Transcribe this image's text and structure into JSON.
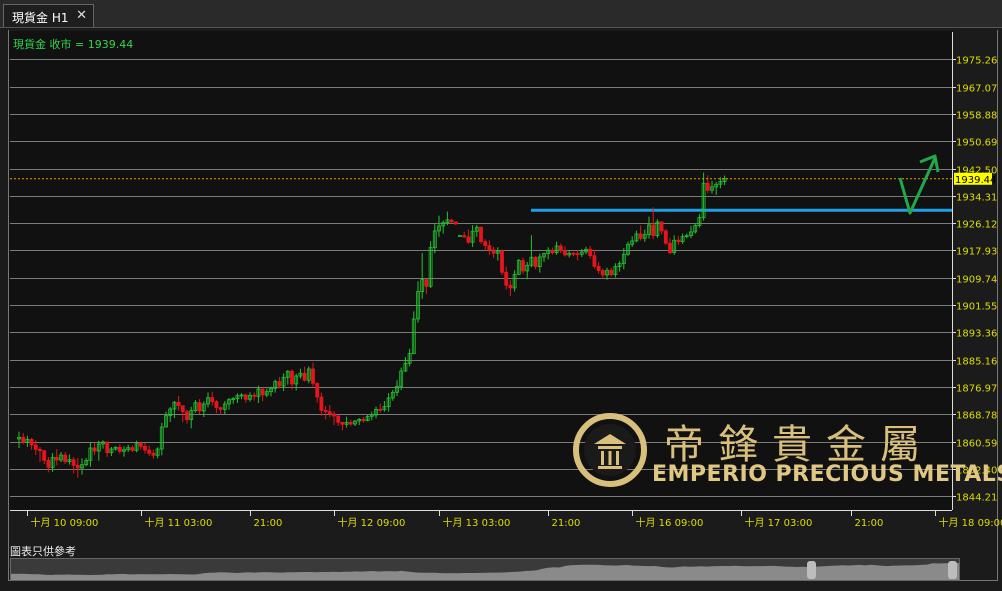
{
  "tab": {
    "label": "現貨金 H1",
    "close_glyph": "✕"
  },
  "legend": {
    "text": "現貨金 收市 = 1939.44"
  },
  "disclaimer": "圖表只供參考",
  "brand": {
    "cn": "帝鋒貴金屬",
    "en": "EMPERIO PRECIOUS METALS"
  },
  "colors": {
    "background": "#111111",
    "grid": "#7a7a7a",
    "up": "#22c32e",
    "down": "#e8141c",
    "axis_text": "#dddd00",
    "price_line": "#e8a000",
    "support_line": "#1ea0e6",
    "arrow": "#22a84a",
    "brand_gold": "#d9bf7c"
  },
  "chart_data": {
    "type": "candlestick",
    "timeframe": "H1",
    "ylim": [
      1840.11,
      1983.45
    ],
    "y_ticks": [
      "1975.26",
      "1967.07",
      "1958.88",
      "1950.69",
      "1942.50",
      "1934.31",
      "1926.12",
      "1917.93",
      "1909.74",
      "1901.55",
      "1893.36",
      "1885.16",
      "1876.97",
      "1868.78",
      "1860.59",
      "1852.40",
      "1844.21"
    ],
    "last_price": "1939.44",
    "x_ticks": [
      "十月 10 09:00",
      "十月 11 03:00",
      "21:00",
      "十月 12 09:00",
      "十月 13 03:00",
      "21:00",
      "十月 16 09:00",
      "十月 17 03:00",
      "21:00",
      "十月 18 09:00"
    ],
    "x_tick_bars": [
      2,
      29,
      55,
      75,
      100,
      126,
      146,
      172,
      198,
      218
    ],
    "support_level": 1930.0,
    "candles": [
      {
        "o": 1861.4,
        "h": 1863.6,
        "l": 1858.7,
        "c": 1861.9
      },
      {
        "o": 1861.9,
        "h": 1863.2,
        "l": 1859.8,
        "c": 1860.4
      },
      {
        "o": 1860.4,
        "h": 1862.4,
        "l": 1859.0,
        "c": 1861.3
      },
      {
        "o": 1861.3,
        "h": 1861.7,
        "l": 1858.2,
        "c": 1859.6
      },
      {
        "o": 1859.6,
        "h": 1861.1,
        "l": 1856.6,
        "c": 1858.3
      },
      {
        "o": 1858.3,
        "h": 1859.0,
        "l": 1854.5,
        "c": 1857.9
      },
      {
        "o": 1857.9,
        "h": 1858.1,
        "l": 1853.9,
        "c": 1855.0
      },
      {
        "o": 1855.0,
        "h": 1856.0,
        "l": 1851.4,
        "c": 1852.9
      },
      {
        "o": 1852.9,
        "h": 1857.2,
        "l": 1851.5,
        "c": 1855.9
      },
      {
        "o": 1855.9,
        "h": 1858.3,
        "l": 1853.5,
        "c": 1855.1
      },
      {
        "o": 1855.1,
        "h": 1857.5,
        "l": 1854.5,
        "c": 1856.6
      },
      {
        "o": 1856.6,
        "h": 1857.5,
        "l": 1853.9,
        "c": 1854.6
      },
      {
        "o": 1854.6,
        "h": 1856.8,
        "l": 1853.7,
        "c": 1855.2
      },
      {
        "o": 1855.2,
        "h": 1856.0,
        "l": 1851.1,
        "c": 1853.5
      },
      {
        "o": 1853.5,
        "h": 1855.7,
        "l": 1849.8,
        "c": 1852.7
      },
      {
        "o": 1852.7,
        "h": 1855.6,
        "l": 1850.7,
        "c": 1853.7
      },
      {
        "o": 1853.7,
        "h": 1855.7,
        "l": 1853.2,
        "c": 1855.0
      },
      {
        "o": 1855.0,
        "h": 1860.3,
        "l": 1853.1,
        "c": 1858.7
      },
      {
        "o": 1858.7,
        "h": 1860.4,
        "l": 1856.6,
        "c": 1857.8
      },
      {
        "o": 1857.8,
        "h": 1860.9,
        "l": 1854.9,
        "c": 1859.9
      },
      {
        "o": 1859.9,
        "h": 1861.0,
        "l": 1858.5,
        "c": 1860.5
      },
      {
        "o": 1860.5,
        "h": 1860.6,
        "l": 1856.0,
        "c": 1857.3
      },
      {
        "o": 1857.3,
        "h": 1859.0,
        "l": 1856.3,
        "c": 1858.4
      },
      {
        "o": 1858.4,
        "h": 1859.2,
        "l": 1857.9,
        "c": 1858.9
      },
      {
        "o": 1858.9,
        "h": 1859.8,
        "l": 1857.0,
        "c": 1857.7
      },
      {
        "o": 1857.7,
        "h": 1859.2,
        "l": 1856.1,
        "c": 1858.2
      },
      {
        "o": 1858.2,
        "h": 1859.7,
        "l": 1857.5,
        "c": 1858.8
      },
      {
        "o": 1858.8,
        "h": 1859.4,
        "l": 1857.5,
        "c": 1858.0
      },
      {
        "o": 1858.0,
        "h": 1860.9,
        "l": 1857.4,
        "c": 1860.2
      },
      {
        "o": 1860.2,
        "h": 1860.6,
        "l": 1858.2,
        "c": 1859.2
      },
      {
        "o": 1859.2,
        "h": 1860.2,
        "l": 1857.0,
        "c": 1858.1
      },
      {
        "o": 1858.1,
        "h": 1859.4,
        "l": 1856.3,
        "c": 1857.1
      },
      {
        "o": 1857.1,
        "h": 1858.2,
        "l": 1855.5,
        "c": 1856.5
      },
      {
        "o": 1856.5,
        "h": 1858.9,
        "l": 1855.6,
        "c": 1858.4
      },
      {
        "o": 1858.4,
        "h": 1866.2,
        "l": 1856.5,
        "c": 1865.0
      },
      {
        "o": 1865.0,
        "h": 1869.6,
        "l": 1864.9,
        "c": 1868.4
      },
      {
        "o": 1868.4,
        "h": 1871.0,
        "l": 1866.5,
        "c": 1870.4
      },
      {
        "o": 1870.4,
        "h": 1872.8,
        "l": 1867.7,
        "c": 1872.4
      },
      {
        "o": 1872.4,
        "h": 1874.3,
        "l": 1869.9,
        "c": 1871.4
      },
      {
        "o": 1871.4,
        "h": 1871.4,
        "l": 1866.4,
        "c": 1869.6
      },
      {
        "o": 1869.6,
        "h": 1870.2,
        "l": 1866.0,
        "c": 1867.2
      },
      {
        "o": 1867.2,
        "h": 1871.1,
        "l": 1864.6,
        "c": 1869.9
      },
      {
        "o": 1869.9,
        "h": 1873.1,
        "l": 1869.3,
        "c": 1872.3
      },
      {
        "o": 1872.3,
        "h": 1873.4,
        "l": 1868.9,
        "c": 1869.8
      },
      {
        "o": 1869.8,
        "h": 1872.7,
        "l": 1868.0,
        "c": 1871.9
      },
      {
        "o": 1871.9,
        "h": 1875.4,
        "l": 1870.9,
        "c": 1873.8
      },
      {
        "o": 1873.8,
        "h": 1875.6,
        "l": 1871.4,
        "c": 1872.6
      },
      {
        "o": 1872.6,
        "h": 1873.1,
        "l": 1869.1,
        "c": 1870.8
      },
      {
        "o": 1870.8,
        "h": 1871.1,
        "l": 1868.7,
        "c": 1870.3
      },
      {
        "o": 1870.3,
        "h": 1872.8,
        "l": 1868.9,
        "c": 1871.9
      },
      {
        "o": 1871.9,
        "h": 1873.7,
        "l": 1870.2,
        "c": 1873.2
      },
      {
        "o": 1873.2,
        "h": 1874.0,
        "l": 1872.0,
        "c": 1873.5
      },
      {
        "o": 1873.5,
        "h": 1875.1,
        "l": 1872.2,
        "c": 1874.4
      },
      {
        "o": 1874.4,
        "h": 1875.1,
        "l": 1873.3,
        "c": 1874.6
      },
      {
        "o": 1874.6,
        "h": 1875.0,
        "l": 1872.3,
        "c": 1873.3
      },
      {
        "o": 1873.3,
        "h": 1875.4,
        "l": 1872.6,
        "c": 1874.5
      },
      {
        "o": 1874.5,
        "h": 1875.3,
        "l": 1872.9,
        "c": 1874.2
      },
      {
        "o": 1874.2,
        "h": 1877.4,
        "l": 1872.2,
        "c": 1876.4
      },
      {
        "o": 1876.4,
        "h": 1876.6,
        "l": 1872.7,
        "c": 1874.6
      },
      {
        "o": 1874.6,
        "h": 1876.6,
        "l": 1873.9,
        "c": 1875.6
      },
      {
        "o": 1875.6,
        "h": 1877.1,
        "l": 1874.2,
        "c": 1876.6
      },
      {
        "o": 1876.6,
        "h": 1879.2,
        "l": 1875.3,
        "c": 1878.6
      },
      {
        "o": 1878.6,
        "h": 1880.0,
        "l": 1876.6,
        "c": 1877.3
      },
      {
        "o": 1877.3,
        "h": 1881.1,
        "l": 1875.8,
        "c": 1879.9
      },
      {
        "o": 1879.9,
        "h": 1882.1,
        "l": 1877.7,
        "c": 1881.7
      },
      {
        "o": 1881.7,
        "h": 1882.3,
        "l": 1876.3,
        "c": 1877.9
      },
      {
        "o": 1877.9,
        "h": 1881.0,
        "l": 1876.0,
        "c": 1880.3
      },
      {
        "o": 1880.3,
        "h": 1882.5,
        "l": 1879.5,
        "c": 1881.1
      },
      {
        "o": 1881.1,
        "h": 1883.1,
        "l": 1878.6,
        "c": 1879.0
      },
      {
        "o": 1879.0,
        "h": 1883.2,
        "l": 1878.1,
        "c": 1882.4
      },
      {
        "o": 1882.4,
        "h": 1884.3,
        "l": 1877.2,
        "c": 1878.1
      },
      {
        "o": 1878.1,
        "h": 1878.3,
        "l": 1872.3,
        "c": 1874.0
      },
      {
        "o": 1874.0,
        "h": 1875.3,
        "l": 1868.4,
        "c": 1870.0
      },
      {
        "o": 1870.0,
        "h": 1871.3,
        "l": 1867.3,
        "c": 1869.6
      },
      {
        "o": 1869.6,
        "h": 1871.6,
        "l": 1867.9,
        "c": 1868.9
      },
      {
        "o": 1868.9,
        "h": 1869.8,
        "l": 1865.6,
        "c": 1868.3
      },
      {
        "o": 1868.3,
        "h": 1868.7,
        "l": 1865.3,
        "c": 1866.4
      },
      {
        "o": 1866.4,
        "h": 1866.5,
        "l": 1864.0,
        "c": 1865.8
      },
      {
        "o": 1865.8,
        "h": 1868.1,
        "l": 1864.8,
        "c": 1866.4
      },
      {
        "o": 1866.4,
        "h": 1867.2,
        "l": 1865.2,
        "c": 1865.9
      },
      {
        "o": 1865.9,
        "h": 1867.1,
        "l": 1865.3,
        "c": 1866.8
      },
      {
        "o": 1866.8,
        "h": 1867.7,
        "l": 1865.6,
        "c": 1867.3
      },
      {
        "o": 1867.3,
        "h": 1868.0,
        "l": 1866.3,
        "c": 1866.9
      },
      {
        "o": 1866.9,
        "h": 1868.6,
        "l": 1866.7,
        "c": 1868.2
      },
      {
        "o": 1868.2,
        "h": 1869.6,
        "l": 1867.0,
        "c": 1868.6
      },
      {
        "o": 1868.6,
        "h": 1871.1,
        "l": 1867.6,
        "c": 1870.3
      },
      {
        "o": 1870.3,
        "h": 1872.0,
        "l": 1869.4,
        "c": 1870.2
      },
      {
        "o": 1870.2,
        "h": 1872.8,
        "l": 1869.6,
        "c": 1871.1
      },
      {
        "o": 1871.1,
        "h": 1875.2,
        "l": 1869.6,
        "c": 1873.7
      },
      {
        "o": 1873.7,
        "h": 1876.1,
        "l": 1872.9,
        "c": 1875.4
      },
      {
        "o": 1875.4,
        "h": 1879.0,
        "l": 1874.3,
        "c": 1877.2
      },
      {
        "o": 1877.2,
        "h": 1882.8,
        "l": 1876.1,
        "c": 1881.8
      },
      {
        "o": 1881.8,
        "h": 1886.0,
        "l": 1881.5,
        "c": 1884.1
      },
      {
        "o": 1884.1,
        "h": 1888.5,
        "l": 1883.2,
        "c": 1887.0
      },
      {
        "o": 1887.0,
        "h": 1899.7,
        "l": 1886.9,
        "c": 1897.4
      },
      {
        "o": 1897.4,
        "h": 1908.7,
        "l": 1896.3,
        "c": 1905.6
      },
      {
        "o": 1905.6,
        "h": 1917.2,
        "l": 1903.4,
        "c": 1909.2
      },
      {
        "o": 1909.2,
        "h": 1909.5,
        "l": 1904.9,
        "c": 1907.2
      },
      {
        "o": 1907.2,
        "h": 1920.7,
        "l": 1906.7,
        "c": 1918.8
      },
      {
        "o": 1918.8,
        "h": 1926.1,
        "l": 1917.1,
        "c": 1923.8
      },
      {
        "o": 1923.8,
        "h": 1928.4,
        "l": 1922.0,
        "c": 1925.3
      },
      {
        "o": 1925.3,
        "h": 1927.0,
        "l": 1923.0,
        "c": 1926.3
      },
      {
        "o": 1926.3,
        "h": 1929.6,
        "l": 1925.5,
        "c": 1927.1
      },
      {
        "o": 1927.1,
        "h": 1927.3,
        "l": 1926.0,
        "c": 1926.5
      },
      {
        "o": 1926.5,
        "h": 1926.6,
        "l": 1925.6,
        "c": 1925.9
      },
      {
        "o": 1922.4,
        "h": 1922.5,
        "l": 1922.3,
        "c": 1922.4
      },
      {
        "o": 1922.4,
        "h": 1923.5,
        "l": 1921.7,
        "c": 1922.0
      },
      {
        "o": 1922.0,
        "h": 1924.2,
        "l": 1919.9,
        "c": 1920.4
      },
      {
        "o": 1920.4,
        "h": 1925.5,
        "l": 1919.0,
        "c": 1923.7
      },
      {
        "o": 1923.7,
        "h": 1925.6,
        "l": 1922.0,
        "c": 1924.9
      },
      {
        "o": 1924.9,
        "h": 1925.1,
        "l": 1919.9,
        "c": 1920.6
      },
      {
        "o": 1920.6,
        "h": 1921.3,
        "l": 1917.9,
        "c": 1919.4
      },
      {
        "o": 1919.4,
        "h": 1921.0,
        "l": 1916.6,
        "c": 1918.1
      },
      {
        "o": 1918.1,
        "h": 1919.0,
        "l": 1915.7,
        "c": 1917.1
      },
      {
        "o": 1917.1,
        "h": 1918.9,
        "l": 1914.9,
        "c": 1917.8
      },
      {
        "o": 1917.8,
        "h": 1918.2,
        "l": 1910.6,
        "c": 1911.4
      },
      {
        "o": 1911.4,
        "h": 1913.1,
        "l": 1906.2,
        "c": 1907.5
      },
      {
        "o": 1907.5,
        "h": 1909.1,
        "l": 1904.3,
        "c": 1906.7
      },
      {
        "o": 1906.7,
        "h": 1912.0,
        "l": 1905.6,
        "c": 1910.8
      },
      {
        "o": 1910.8,
        "h": 1915.4,
        "l": 1910.5,
        "c": 1914.9
      },
      {
        "o": 1914.9,
        "h": 1915.8,
        "l": 1910.9,
        "c": 1911.8
      },
      {
        "o": 1911.8,
        "h": 1914.5,
        "l": 1909.3,
        "c": 1913.5
      },
      {
        "o": 1913.5,
        "h": 1922.5,
        "l": 1912.9,
        "c": 1915.9
      },
      {
        "o": 1915.9,
        "h": 1916.2,
        "l": 1912.3,
        "c": 1913.1
      },
      {
        "o": 1913.1,
        "h": 1917.0,
        "l": 1911.3,
        "c": 1916.0
      },
      {
        "o": 1916.0,
        "h": 1917.3,
        "l": 1914.5,
        "c": 1917.0
      },
      {
        "o": 1917.0,
        "h": 1918.9,
        "l": 1915.3,
        "c": 1918.0
      },
      {
        "o": 1918.0,
        "h": 1918.8,
        "l": 1916.7,
        "c": 1917.3
      },
      {
        "o": 1917.3,
        "h": 1920.6,
        "l": 1916.6,
        "c": 1919.3
      },
      {
        "o": 1919.3,
        "h": 1920.0,
        "l": 1917.1,
        "c": 1917.9
      },
      {
        "o": 1917.9,
        "h": 1919.2,
        "l": 1916.1,
        "c": 1916.6
      },
      {
        "o": 1916.6,
        "h": 1918.0,
        "l": 1915.8,
        "c": 1917.1
      },
      {
        "o": 1917.1,
        "h": 1917.5,
        "l": 1916.2,
        "c": 1917.0
      },
      {
        "o": 1917.0,
        "h": 1918.0,
        "l": 1914.9,
        "c": 1916.8
      },
      {
        "o": 1916.8,
        "h": 1918.4,
        "l": 1916.0,
        "c": 1917.5
      },
      {
        "o": 1917.5,
        "h": 1919.0,
        "l": 1916.8,
        "c": 1918.3
      },
      {
        "o": 1918.3,
        "h": 1919.3,
        "l": 1915.5,
        "c": 1916.4
      },
      {
        "o": 1916.4,
        "h": 1918.2,
        "l": 1912.6,
        "c": 1913.2
      },
      {
        "o": 1913.2,
        "h": 1914.5,
        "l": 1911.0,
        "c": 1911.9
      },
      {
        "o": 1911.9,
        "h": 1912.5,
        "l": 1909.8,
        "c": 1910.6
      },
      {
        "o": 1910.6,
        "h": 1912.8,
        "l": 1909.2,
        "c": 1912.0
      },
      {
        "o": 1912.0,
        "h": 1912.8,
        "l": 1910.1,
        "c": 1910.7
      },
      {
        "o": 1910.7,
        "h": 1914.1,
        "l": 1909.8,
        "c": 1913.1
      },
      {
        "o": 1913.1,
        "h": 1914.7,
        "l": 1911.6,
        "c": 1914.0
      },
      {
        "o": 1914.0,
        "h": 1918.7,
        "l": 1912.3,
        "c": 1916.8
      },
      {
        "o": 1916.8,
        "h": 1920.6,
        "l": 1916.3,
        "c": 1919.8
      },
      {
        "o": 1919.8,
        "h": 1922.2,
        "l": 1919.0,
        "c": 1920.8
      },
      {
        "o": 1920.8,
        "h": 1923.9,
        "l": 1920.4,
        "c": 1922.9
      },
      {
        "o": 1922.9,
        "h": 1925.4,
        "l": 1920.9,
        "c": 1921.6
      },
      {
        "o": 1921.6,
        "h": 1924.2,
        "l": 1920.5,
        "c": 1922.7
      },
      {
        "o": 1922.7,
        "h": 1928.1,
        "l": 1921.5,
        "c": 1925.6
      },
      {
        "o": 1925.6,
        "h": 1930.9,
        "l": 1921.3,
        "c": 1922.4
      },
      {
        "o": 1922.4,
        "h": 1927.3,
        "l": 1921.7,
        "c": 1926.5
      },
      {
        "o": 1926.5,
        "h": 1926.7,
        "l": 1922.7,
        "c": 1923.8
      },
      {
        "o": 1923.8,
        "h": 1924.4,
        "l": 1919.6,
        "c": 1920.1
      },
      {
        "o": 1920.1,
        "h": 1921.6,
        "l": 1916.8,
        "c": 1917.3
      },
      {
        "o": 1917.3,
        "h": 1922.5,
        "l": 1916.6,
        "c": 1921.0
      },
      {
        "o": 1921.0,
        "h": 1922.2,
        "l": 1919.6,
        "c": 1920.6
      },
      {
        "o": 1920.6,
        "h": 1923.0,
        "l": 1919.9,
        "c": 1922.1
      },
      {
        "o": 1922.1,
        "h": 1923.0,
        "l": 1921.6,
        "c": 1922.4
      },
      {
        "o": 1922.4,
        "h": 1925.3,
        "l": 1921.6,
        "c": 1923.5
      },
      {
        "o": 1923.5,
        "h": 1926.1,
        "l": 1923.0,
        "c": 1925.4
      },
      {
        "o": 1925.4,
        "h": 1928.9,
        "l": 1924.8,
        "c": 1927.8
      },
      {
        "o": 1927.8,
        "h": 1941.3,
        "l": 1926.9,
        "c": 1938.1
      },
      {
        "o": 1938.1,
        "h": 1940.5,
        "l": 1935.1,
        "c": 1936.0
      },
      {
        "o": 1936.0,
        "h": 1938.8,
        "l": 1935.0,
        "c": 1937.0
      },
      {
        "o": 1937.0,
        "h": 1938.5,
        "l": 1934.6,
        "c": 1937.8
      },
      {
        "o": 1937.8,
        "h": 1939.9,
        "l": 1936.6,
        "c": 1938.6
      },
      {
        "o": 1938.6,
        "h": 1940.4,
        "l": 1937.5,
        "c": 1939.44
      }
    ]
  }
}
